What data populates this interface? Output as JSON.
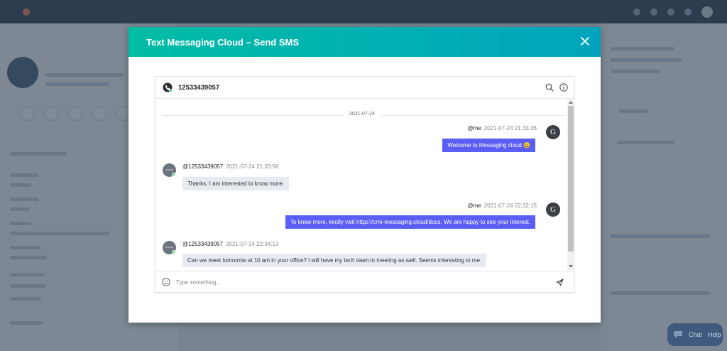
{
  "modal": {
    "title": "Text Messaging Cloud – Send SMS"
  },
  "conversation": {
    "phone_number": "12533439057",
    "date_separator": "2021-07-24",
    "messages": [
      {
        "direction": "out",
        "sender": "@me",
        "time": "2021-07-24 21:33:36",
        "text": "Welcome to Messaging cloud 😀",
        "avatar_letter": "G"
      },
      {
        "direction": "in",
        "sender": "@12533439057",
        "time": "2021-07-24 21:33:58",
        "text": "Thanks, I am interested to know more."
      },
      {
        "direction": "out",
        "sender": "@me",
        "time": "2021-07-24 22:32:15",
        "text": "To know more, kindly visit https'//crm-messaging.cloud/docs. We are happy to see your interest.",
        "avatar_letter": "G"
      },
      {
        "direction": "in",
        "sender": "@12533439057",
        "time": "2021-07-24 22:34:13",
        "text": "Can we meet tomorrow at 10 am in your office? I will have my tech team in meeting as well. Seems interesting to me."
      }
    ]
  },
  "composer": {
    "placeholder": "Type something..."
  },
  "chat_widget": {
    "chat_label": "Chat",
    "help_label": "Help"
  },
  "colors": {
    "header_gradient_start": "#00bda5",
    "header_gradient_end": "#00a4bd",
    "outgoing_bubble": "#5b5ef5",
    "incoming_bubble": "#e8eaf1"
  }
}
